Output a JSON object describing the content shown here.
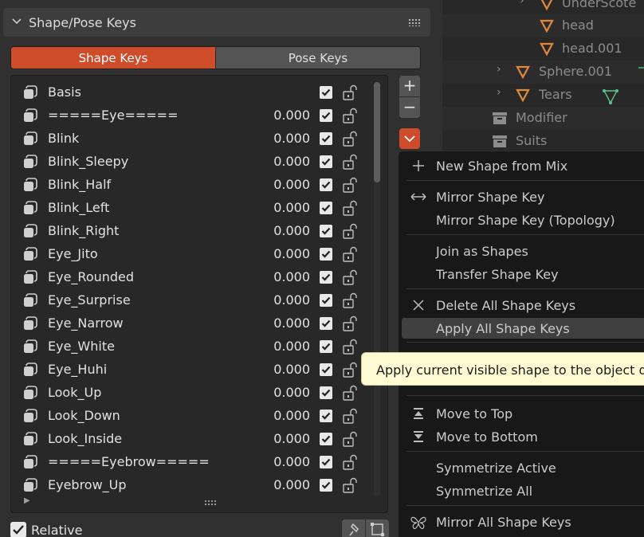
{
  "panel": {
    "title": "Shape/Pose Keys",
    "tabs": [
      {
        "label": "Shape Keys",
        "active": true
      },
      {
        "label": "Pose Keys",
        "active": false
      }
    ],
    "shape_keys": [
      {
        "name": "Basis",
        "value": "",
        "enabled": true
      },
      {
        "name": "=====Eye=====",
        "value": "0.000",
        "enabled": true
      },
      {
        "name": "Blink",
        "value": "0.000",
        "enabled": true
      },
      {
        "name": "Blink_Sleepy",
        "value": "0.000",
        "enabled": true
      },
      {
        "name": "Blink_Half",
        "value": "0.000",
        "enabled": true
      },
      {
        "name": "Blink_Left",
        "value": "0.000",
        "enabled": true
      },
      {
        "name": "Blink_Right",
        "value": "0.000",
        "enabled": true
      },
      {
        "name": "Eye_Jito",
        "value": "0.000",
        "enabled": true
      },
      {
        "name": "Eye_Rounded",
        "value": "0.000",
        "enabled": true
      },
      {
        "name": "Eye_Surprise",
        "value": "0.000",
        "enabled": true
      },
      {
        "name": "Eye_Narrow",
        "value": "0.000",
        "enabled": true
      },
      {
        "name": "Eye_White",
        "value": "0.000",
        "enabled": true
      },
      {
        "name": "Eye_Huhi",
        "value": "0.000",
        "enabled": true
      },
      {
        "name": "Look_Up",
        "value": "0.000",
        "enabled": true
      },
      {
        "name": "Look_Down",
        "value": "0.000",
        "enabled": true
      },
      {
        "name": "Look_Inside",
        "value": "0.000",
        "enabled": true
      },
      {
        "name": "=====Eyebrow=====",
        "value": "0.000",
        "enabled": true
      },
      {
        "name": "Eyebrow_Up",
        "value": "0.000",
        "enabled": true
      }
    ],
    "add_label": "+",
    "remove_label": "−",
    "relative_label": "Relative",
    "relative_checked": true
  },
  "outliner": {
    "rows": [
      {
        "name": "UnderScote",
        "expandable": true,
        "icon": "mesh-triangle-icon",
        "depth": 2
      },
      {
        "name": "head",
        "expandable": false,
        "icon": "mesh-triangle-icon",
        "depth": 2
      },
      {
        "name": "head.001",
        "expandable": false,
        "icon": "mesh-triangle-icon",
        "depth": 2
      },
      {
        "name": "Sphere.001",
        "expandable": true,
        "icon": "mesh-triangle-icon",
        "depth": 1
      },
      {
        "name": "Tears",
        "expandable": true,
        "icon": "mesh-triangle-icon",
        "depth": 1
      },
      {
        "name": "Modifier",
        "expandable": false,
        "icon": "collection-box-icon",
        "depth": 0
      },
      {
        "name": "Suits",
        "expandable": false,
        "icon": "collection-box-icon",
        "depth": 0
      }
    ]
  },
  "menu": {
    "items": [
      {
        "label": "New Shape from Mix",
        "icon": "plus-icon"
      },
      {
        "label": "Mirror Shape Key",
        "icon": "mirror-arrows-icon"
      },
      {
        "label": "Mirror Shape Key (Topology)",
        "icon": ""
      },
      {
        "label": "Join as Shapes",
        "icon": ""
      },
      {
        "label": "Transfer Shape Key",
        "icon": ""
      },
      {
        "label": "Delete All Shape Keys",
        "icon": "x-icon"
      },
      {
        "label": "Apply All Shape Keys",
        "icon": "",
        "highlighted": true
      },
      {
        "label": "Move to Top",
        "icon": "move-top-icon"
      },
      {
        "label": "Move to Bottom",
        "icon": "move-bottom-icon"
      },
      {
        "label": "Symmetrize Active",
        "icon": ""
      },
      {
        "label": "Symmetrize All",
        "icon": ""
      },
      {
        "label": "Mirror All Shape Keys",
        "icon": "butterfly-icon"
      }
    ]
  },
  "tooltip": {
    "text": "Apply current visible shape to the object data"
  },
  "colors": {
    "accent": "#cf4c2b",
    "panel_bg": "#303030",
    "list_bg": "#282828",
    "menu_bg": "#181818",
    "tooltip_bg": "#fffbd2",
    "mesh_icon": "#e0893c"
  }
}
